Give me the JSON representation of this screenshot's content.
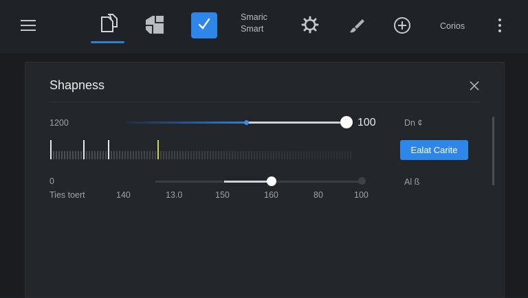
{
  "toolbar": {
    "smart_line1": "Smaric",
    "smart_line2": "Smart",
    "corios_label": "Corios",
    "icons": [
      "menu-icon",
      "document-icon",
      "layers-icon",
      "check-icon",
      "settings-icon",
      "brush-icon",
      "add-circle-icon",
      "more-vert-icon"
    ]
  },
  "panel": {
    "title": "Shapness",
    "slider1": {
      "left_label": "1200",
      "value_label": "100",
      "right_label": "Dn ¢",
      "level": 0.99
    },
    "apply_button": "Ealat Carite",
    "slider2": {
      "left_label": "0",
      "right_label": "Al ß",
      "level": 0.56
    },
    "axis": {
      "caption": "Ties toert",
      "ticks": [
        "140",
        "13.0",
        "150",
        "160",
        "80",
        "100"
      ]
    }
  },
  "colors": {
    "accent": "#2e86e8",
    "background": "#1b1e23",
    "panel": "#23262b"
  }
}
